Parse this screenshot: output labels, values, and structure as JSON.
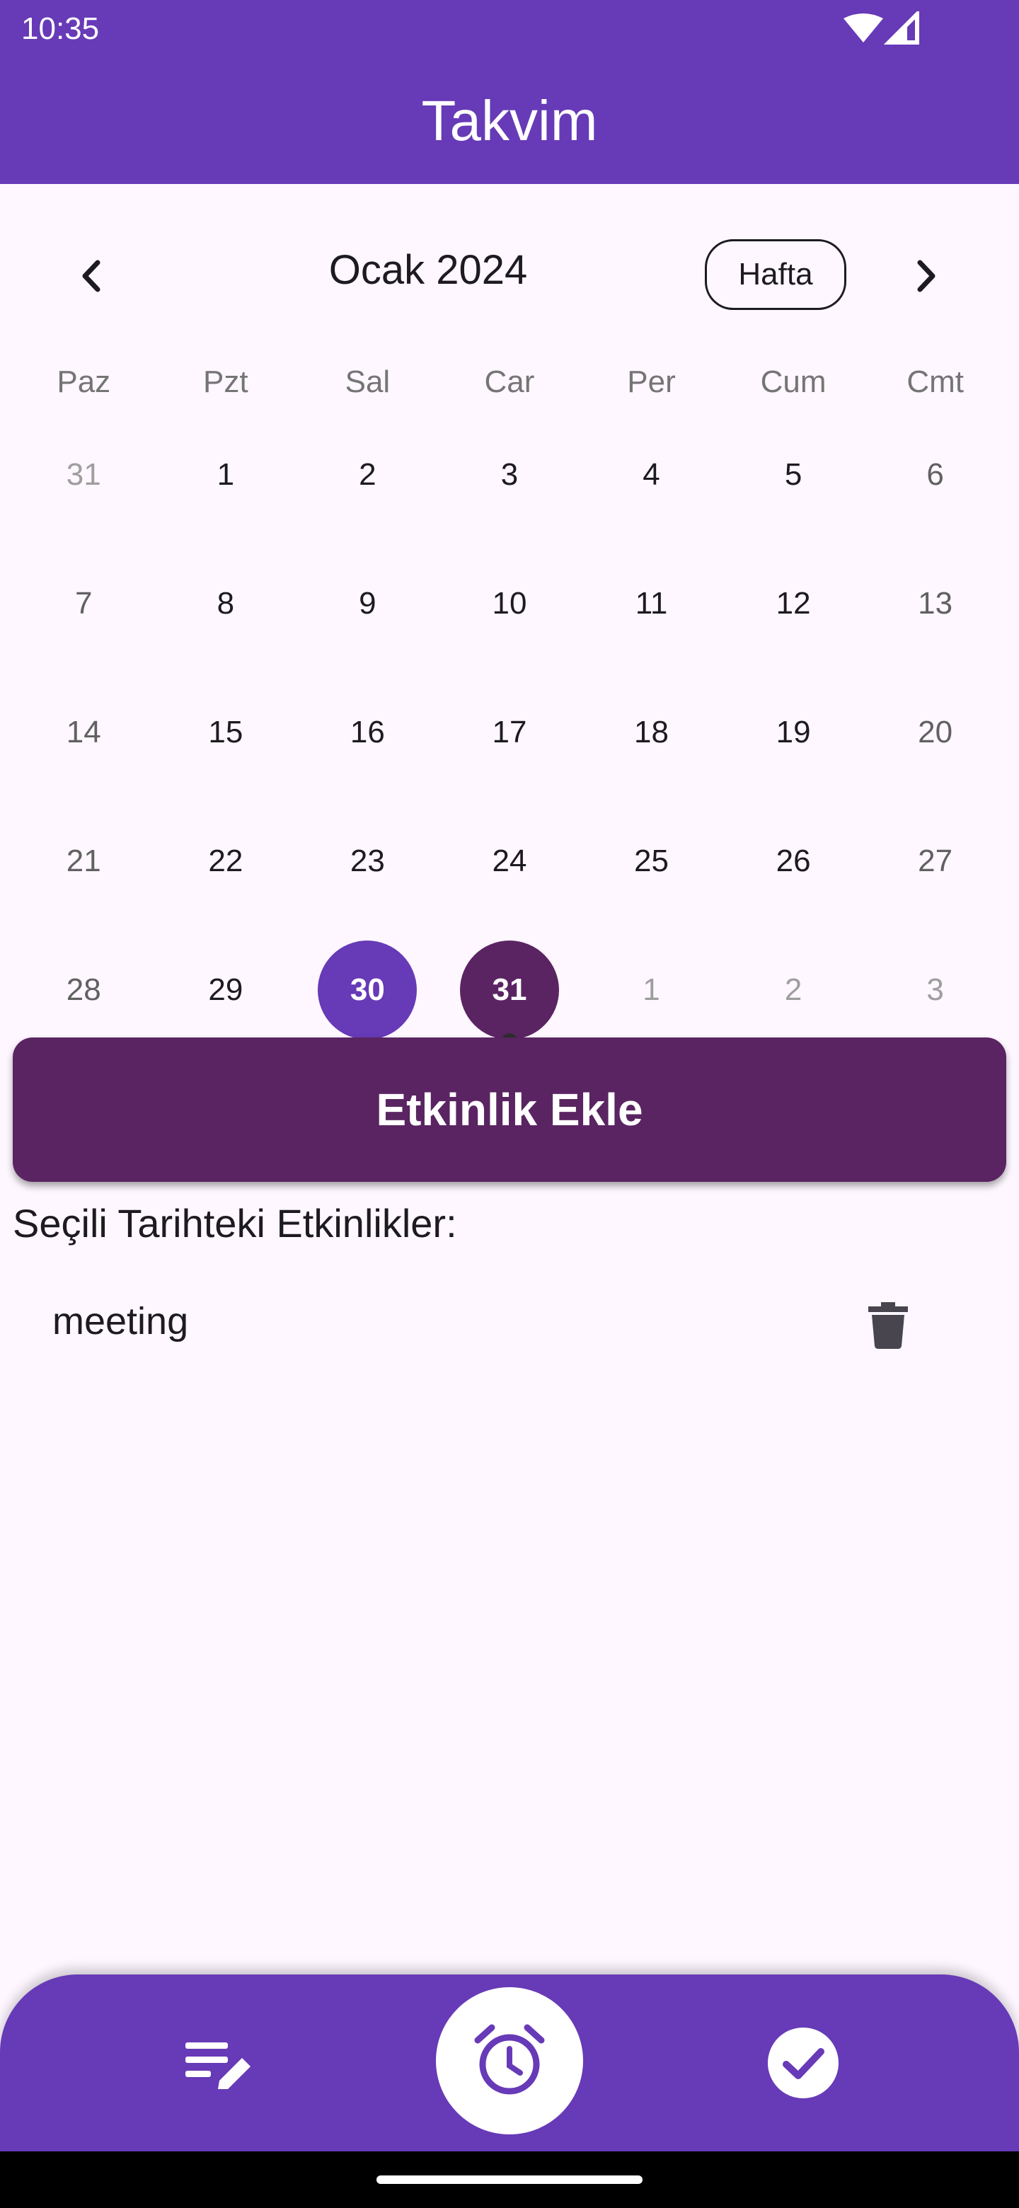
{
  "status": {
    "time": "10:35"
  },
  "appbar": {
    "title": "Takvim"
  },
  "calendar": {
    "month_title": "Ocak 2024",
    "format_button": "Hafta",
    "weekdays": [
      "Paz",
      "Pzt",
      "Sal",
      "Car",
      "Per",
      "Cum",
      "Cmt"
    ],
    "weeks": [
      [
        "31",
        "1",
        "2",
        "3",
        "4",
        "5",
        "6"
      ],
      [
        "7",
        "8",
        "9",
        "10",
        "11",
        "12",
        "13"
      ],
      [
        "14",
        "15",
        "16",
        "17",
        "18",
        "19",
        "20"
      ],
      [
        "21",
        "22",
        "23",
        "24",
        "25",
        "26",
        "27"
      ],
      [
        "28",
        "29",
        "30",
        "31",
        "1",
        "2",
        "3"
      ]
    ],
    "today": "30",
    "selected": "31",
    "colors": {
      "today": "#673ab7",
      "selected": "#5a2462"
    }
  },
  "actions": {
    "add_event_label": "Etkinlik Ekle"
  },
  "events": {
    "title": "Seçili Tarihteki Etkinlikler:",
    "items": [
      {
        "label": "meeting"
      }
    ]
  },
  "bottom_nav": {
    "items": [
      "edit-note-icon",
      "alarm-icon",
      "check-circle-icon"
    ]
  },
  "theme": {
    "primary": "#673ab7",
    "accent": "#5a2462",
    "background": "#fef7ff"
  }
}
